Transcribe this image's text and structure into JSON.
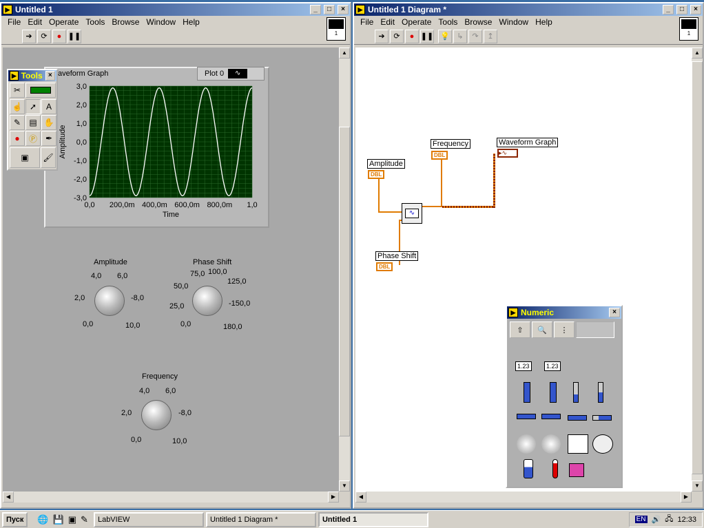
{
  "front": {
    "title": "Untitled 1",
    "menu": [
      "File",
      "Edit",
      "Operate",
      "Tools",
      "Browse",
      "Window",
      "Help"
    ],
    "vi_index": "1"
  },
  "graph": {
    "label": "Waveform Graph",
    "plot_legend": "Plot 0",
    "ylabel": "Amplitude",
    "xlabel": "Time",
    "yticks": [
      "3,0",
      "2,0",
      "1,0",
      "0,0",
      "-1,0",
      "-2,0",
      "-3,0"
    ],
    "xticks": [
      "0,0",
      "200,0m",
      "400,0m",
      "600,0m",
      "800,0m",
      "1,0"
    ]
  },
  "chart_data": {
    "type": "line",
    "title": "Waveform Graph",
    "xlabel": "Time",
    "ylabel": "Amplitude",
    "xlim": [
      0,
      1
    ],
    "ylim": [
      -3,
      3
    ],
    "series": [
      {
        "name": "Plot 0",
        "function": "sine",
        "amplitude": 2.9,
        "cycles": 3.5,
        "phase_deg": -90
      }
    ],
    "grid": true,
    "background": "#003300",
    "line_color": "#ffffff"
  },
  "knobs": {
    "amplitude": {
      "label": "Amplitude",
      "ticks": [
        "4,0",
        "6,0",
        "2,0",
        "-8,0",
        "0,0",
        "10,0"
      ]
    },
    "phase": {
      "label": "Phase Shift",
      "ticks": [
        "75,0",
        "100,0",
        "125,0",
        "50,0",
        "25,0",
        "-150,0",
        "0,0",
        "180,0"
      ]
    },
    "frequency": {
      "label": "Frequency",
      "ticks": [
        "4,0",
        "6,0",
        "2,0",
        "-8,0",
        "0,0",
        "10,0"
      ]
    }
  },
  "tools": {
    "title": "Tools"
  },
  "diagram": {
    "title": "Untitled 1 Diagram *",
    "menu": [
      "File",
      "Edit",
      "Operate",
      "Tools",
      "Browse",
      "Window",
      "Help"
    ],
    "vi_index": "1",
    "nodes": {
      "amplitude": "Amplitude",
      "frequency": "Frequency",
      "graph": "Waveform Graph",
      "phase": "Phase Shift"
    },
    "term_dbl": "DBL"
  },
  "numeric": {
    "title": "Numeric",
    "num_a": "1.23",
    "num_b": "1.23"
  },
  "taskbar": {
    "start": "Пуск",
    "tasks": [
      "LabVIEW",
      "Untitled 1 Diagram *",
      "Untitled 1"
    ],
    "lang": "EN",
    "clock": "12:33"
  }
}
